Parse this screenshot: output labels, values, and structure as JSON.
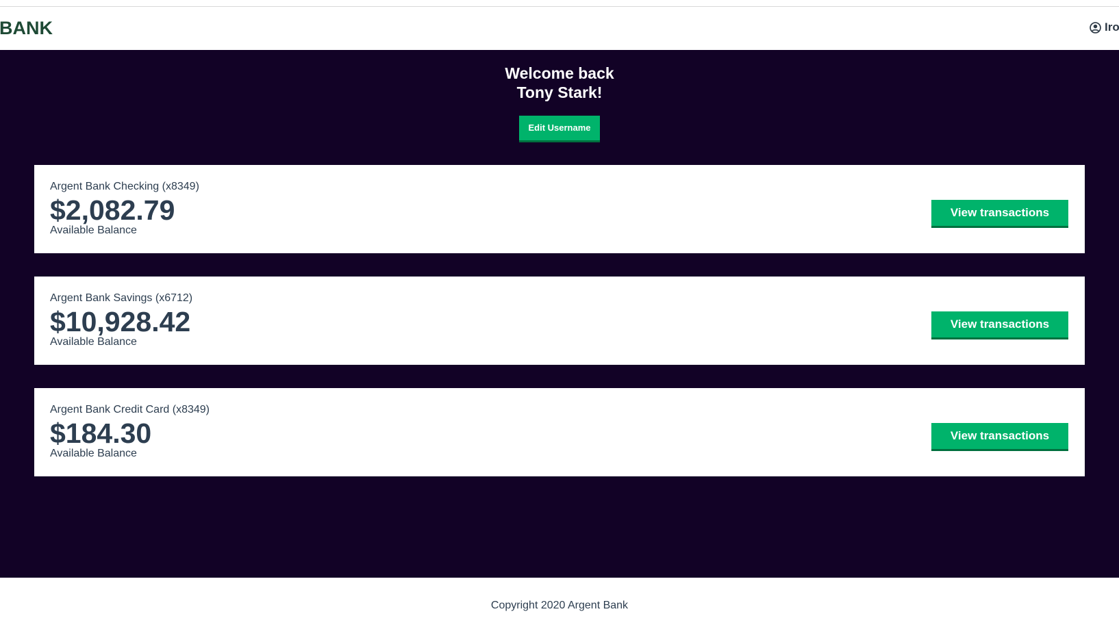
{
  "header": {
    "logo_text": "BANK",
    "user_name": "Iro"
  },
  "welcome": {
    "line1": "Welcome back",
    "line2": "Tony Stark!",
    "edit_button_label": "Edit Username"
  },
  "accounts": [
    {
      "name": "Argent Bank Checking (x8349)",
      "balance": "$2,082.79",
      "balance_label": "Available Balance",
      "button_label": "View transactions"
    },
    {
      "name": "Argent Bank Savings (x6712)",
      "balance": "$10,928.42",
      "balance_label": "Available Balance",
      "button_label": "View transactions"
    },
    {
      "name": "Argent Bank Credit Card (x8349)",
      "balance": "$184.30",
      "balance_label": "Available Balance",
      "button_label": "View transactions"
    }
  ],
  "footer": {
    "text": "Copyright 2020 Argent Bank"
  },
  "icons": {
    "user": "user-circle-icon"
  },
  "colors": {
    "brand_dark": "#1e4a35",
    "main_background": "#120226",
    "button": "#00b36b",
    "button_border": "#00703f",
    "text": "#2d3e50"
  }
}
